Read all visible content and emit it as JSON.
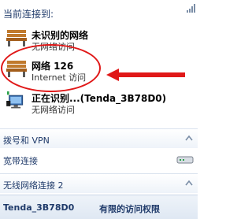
{
  "header": "当前连接到:",
  "networks": [
    {
      "name": "未识别的网络",
      "status": "无网络访问",
      "icon": "bench-network-icon"
    },
    {
      "name": "网络  126",
      "status": "Internet 访问",
      "icon": "bench-network-icon"
    },
    {
      "name": "正在识别...(Tenda_3B78D0)",
      "status": "无网络访问",
      "icon": "wireless-monitor-icon"
    }
  ],
  "groups": {
    "dialup": "拨号和 VPN",
    "broadband": "宽带连接",
    "wireless": "无线网络连接 2"
  },
  "wireless_item": {
    "ssid": "Tenda_3B78D0",
    "status": "有限的访问权限"
  },
  "colors": {
    "highlight": "#e01818",
    "header_text": "#1f3a6a"
  }
}
